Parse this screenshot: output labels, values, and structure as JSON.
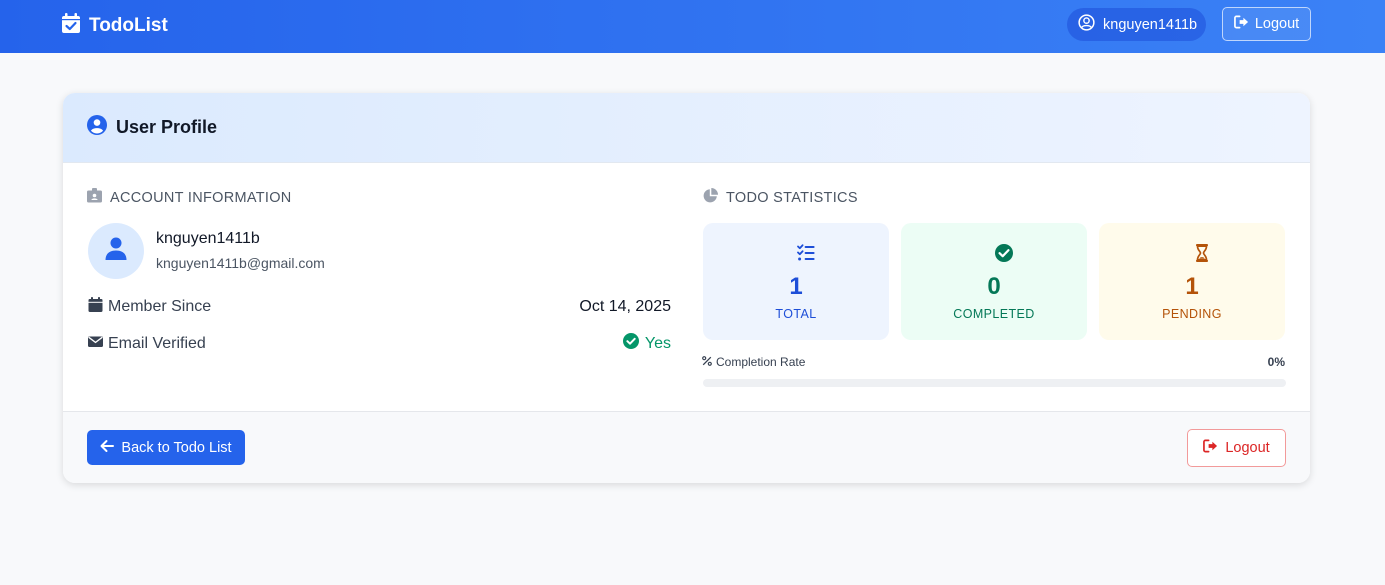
{
  "navbar": {
    "brand": "TodoList",
    "username": "knguyen1411b",
    "logout_label": "Logout"
  },
  "profile": {
    "title": "User Profile",
    "account_section": "ACCOUNT INFORMATION",
    "username": "knguyen1411b",
    "email": "knguyen1411b@gmail.com",
    "member_since_label": "Member Since",
    "member_since_value": "Oct 14, 2025",
    "email_verified_label": "Email Verified",
    "email_verified_value": "Yes"
  },
  "stats": {
    "section_title": "TODO STATISTICS",
    "total": {
      "value": "1",
      "label": "TOTAL"
    },
    "completed": {
      "value": "0",
      "label": "COMPLETED"
    },
    "pending": {
      "value": "1",
      "label": "PENDING"
    },
    "completion_label": "Completion Rate",
    "completion_value": "0%",
    "completion_fraction": 0
  },
  "footer": {
    "back_label": "Back to Todo List",
    "logout_label": "Logout"
  },
  "colors": {
    "primary": "#2563eb",
    "success": "#059669",
    "pending": "#b45309",
    "danger": "#dc2626"
  },
  "icons": {
    "brand": "calendar-check-icon",
    "user": "user-circle-icon",
    "logout": "sign-out-icon",
    "account": "id-badge-icon",
    "stats": "pie-chart-icon",
    "member_since": "calendar-icon",
    "email": "envelope-icon",
    "verified": "check-circle-icon",
    "total": "list-check-icon",
    "completed": "check-circle-icon",
    "pending": "hourglass-icon",
    "percent": "percent-icon",
    "back": "arrow-left-icon"
  }
}
